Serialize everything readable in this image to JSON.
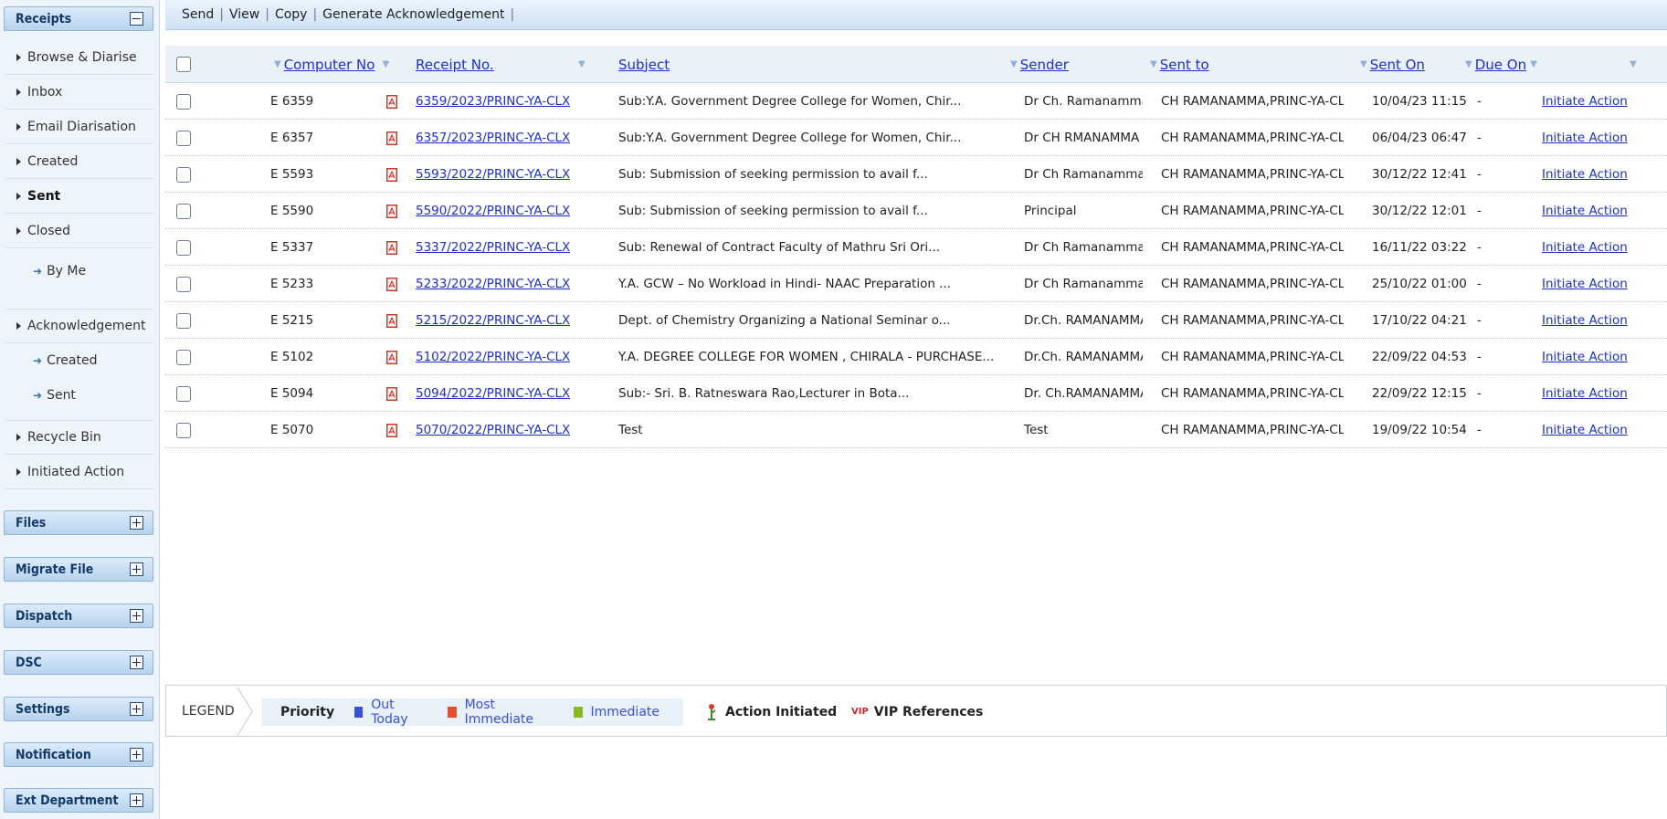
{
  "sidebar": {
    "sections": [
      {
        "label": "Receipts",
        "state": "collapse"
      },
      {
        "label": "Files",
        "state": "expand"
      },
      {
        "label": "Migrate File",
        "state": "expand"
      },
      {
        "label": "Dispatch",
        "state": "expand"
      },
      {
        "label": "DSC",
        "state": "expand"
      },
      {
        "label": "Settings",
        "state": "expand"
      },
      {
        "label": "Notification",
        "state": "expand"
      },
      {
        "label": "Ext Department",
        "state": "expand"
      }
    ],
    "items": [
      {
        "label": "Browse & Diarise"
      },
      {
        "label": "Inbox"
      },
      {
        "label": "Email Diarisation"
      },
      {
        "label": "Created"
      },
      {
        "label": "Sent"
      },
      {
        "label": "Closed"
      },
      {
        "label": "By Me"
      },
      {
        "label": "Acknowledgement"
      },
      {
        "label": "Created"
      },
      {
        "label": "Sent"
      },
      {
        "label": "Recycle Bin"
      },
      {
        "label": "Initiated Action"
      }
    ]
  },
  "toolbar": {
    "actions": [
      "Send",
      "View",
      "Copy",
      "Generate Acknowledgement"
    ]
  },
  "table": {
    "headers": {
      "computer_no": "Computer No",
      "receipt_no": "Receipt No.",
      "subject": "Subject",
      "sender": "Sender",
      "sent_to": "Sent to",
      "sent_on": "Sent On",
      "due_on": "Due On"
    },
    "rows": [
      {
        "computer_no": "E 6359",
        "receipt_no": "6359/2023/PRINC-YA-CLX",
        "subject": "Sub:Y.A. Government Degree College for Women, Chir...",
        "sender": "Dr Ch. Ramanamma",
        "sent_to": "CH RAMANAMMA,PRINC-YA-CLX",
        "sent_on": "10/04/23 11:15",
        "due_on": "-",
        "action": "Initiate Action"
      },
      {
        "computer_no": "E 6357",
        "receipt_no": "6357/2023/PRINC-YA-CLX",
        "subject": "Sub:Y.A. Government Degree College for Women, Chir...",
        "sender": "Dr CH RMANAMMA",
        "sent_to": "CH RAMANAMMA,PRINC-YA-CLX",
        "sent_on": "06/04/23 06:47",
        "due_on": "-",
        "action": "Initiate Action"
      },
      {
        "computer_no": "E 5593",
        "receipt_no": "5593/2022/PRINC-YA-CLX",
        "subject": "Sub: Submission of seeking permission to avail f...",
        "sender": "Dr Ch Ramanamma",
        "sent_to": "CH RAMANAMMA,PRINC-YA-CLX",
        "sent_on": "30/12/22 12:41",
        "due_on": "-",
        "action": "Initiate Action"
      },
      {
        "computer_no": "E 5590",
        "receipt_no": "5590/2022/PRINC-YA-CLX",
        "subject": "Sub: Submission of seeking permission to avail f...",
        "sender": "Principal",
        "sent_to": "CH RAMANAMMA,PRINC-YA-CLX",
        "sent_on": "30/12/22 12:01",
        "due_on": "-",
        "action": "Initiate Action"
      },
      {
        "computer_no": "E 5337",
        "receipt_no": "5337/2022/PRINC-YA-CLX",
        "subject": "Sub: Renewal of Contract Faculty of Mathru Sri Ori...",
        "sender": "Dr Ch Ramanamma",
        "sent_to": "CH RAMANAMMA,PRINC-YA-CLX",
        "sent_on": "16/11/22 03:22",
        "due_on": "-",
        "action": "Initiate Action"
      },
      {
        "computer_no": "E 5233",
        "receipt_no": "5233/2022/PRINC-YA-CLX",
        "subject": "Y.A. GCW – No Workload in Hindi- NAAC Preparation ...",
        "sender": "Dr Ch Ramanamma",
        "sent_to": "CH RAMANAMMA,PRINC-YA-CLX",
        "sent_on": "25/10/22 01:00",
        "due_on": "-",
        "action": "Initiate Action"
      },
      {
        "computer_no": "E 5215",
        "receipt_no": "5215/2022/PRINC-YA-CLX",
        "subject": "Dept. of Chemistry Organizing a National Seminar o...",
        "sender": "Dr.Ch. RAMANAMMA",
        "sent_to": "CH RAMANAMMA,PRINC-YA-CLX",
        "sent_on": "17/10/22 04:21",
        "due_on": "-",
        "action": "Initiate Action"
      },
      {
        "computer_no": "E 5102",
        "receipt_no": "5102/2022/PRINC-YA-CLX",
        "subject": "Y.A. DEGREE COLLEGE FOR WOMEN , CHIRALA - PURCHASE...",
        "sender": "Dr.Ch. RAMANAMMA",
        "sent_to": "CH RAMANAMMA,PRINC-YA-CLX",
        "sent_on": "22/09/22 04:53",
        "due_on": "-",
        "action": "Initiate Action"
      },
      {
        "computer_no": "E 5094",
        "receipt_no": "5094/2022/PRINC-YA-CLX",
        "subject": "Sub:- Sri. B. Ratneswara Rao,Lecturer in Bota...",
        "sender": "Dr. Ch.RAMANAMMA",
        "sent_to": "CH RAMANAMMA,PRINC-YA-CLX",
        "sent_on": "22/09/22 12:15",
        "due_on": "-",
        "action": "Initiate Action"
      },
      {
        "computer_no": "E 5070",
        "receipt_no": "5070/2022/PRINC-YA-CLX",
        "subject": "Test",
        "sender": "Test",
        "sent_to": "CH RAMANAMMA,PRINC-YA-CLX",
        "sent_on": "19/09/22 10:54",
        "due_on": "-",
        "action": "Initiate Action"
      }
    ]
  },
  "legend": {
    "title": "LEGEND",
    "priority_label": "Priority",
    "priorities": [
      {
        "label": "Out Today",
        "color": "#3b4fd6"
      },
      {
        "label": "Most Immediate",
        "color": "#e2502f"
      },
      {
        "label": "Immediate",
        "color": "#88b72a"
      }
    ],
    "action_initiated": "Action Initiated",
    "vip_badge": "VIP",
    "vip_label": "VIP References"
  },
  "colors": {
    "link": "#1d2fc9",
    "section_header": "#123a66",
    "pdf_icon": "#c83a2b"
  }
}
